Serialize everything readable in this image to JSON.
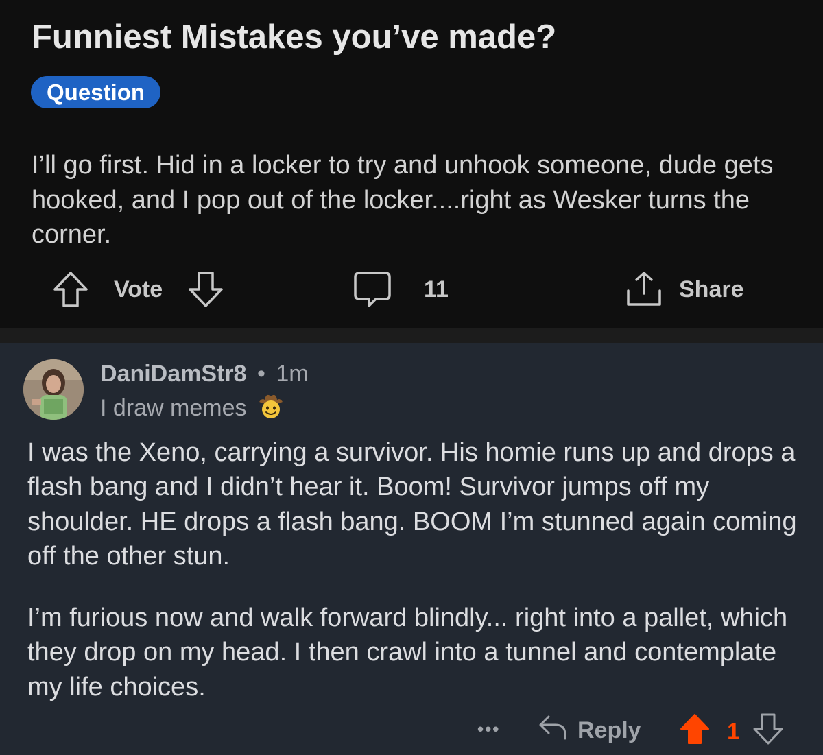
{
  "post": {
    "title": "Funniest Mistakes you’ve made?",
    "flair": "Question",
    "flair_color": "#1f63c4",
    "body": "I’ll go first. Hid in a locker to try and unhook someone, dude gets hooked, and I pop out of the locker....right as Wesker turns the corner.",
    "vote_label": "Vote",
    "comment_count": "11",
    "share_label": "Share"
  },
  "comment": {
    "username": "DaniDamStr8",
    "separator": "•",
    "time": "1m",
    "user_flair": "I draw memes",
    "flair_emoji": "cowboy-face-emoji",
    "paragraphs": [
      "I was the Xeno, carrying a survivor. His homie runs up and drops a flash bang and I didn’t hear it. Boom! Survivor jumps off my shoulder. HE drops a flash bang. BOOM I’m stunned again coming off the other stun.",
      "I’m furious now and walk forward blindly... right into a pallet, which they drop on my head. I then crawl into a tunnel and contemplate my life choices."
    ],
    "more_label": "•••",
    "reply_label": "Reply",
    "score": "1",
    "upvote_color": "#ff4500"
  }
}
